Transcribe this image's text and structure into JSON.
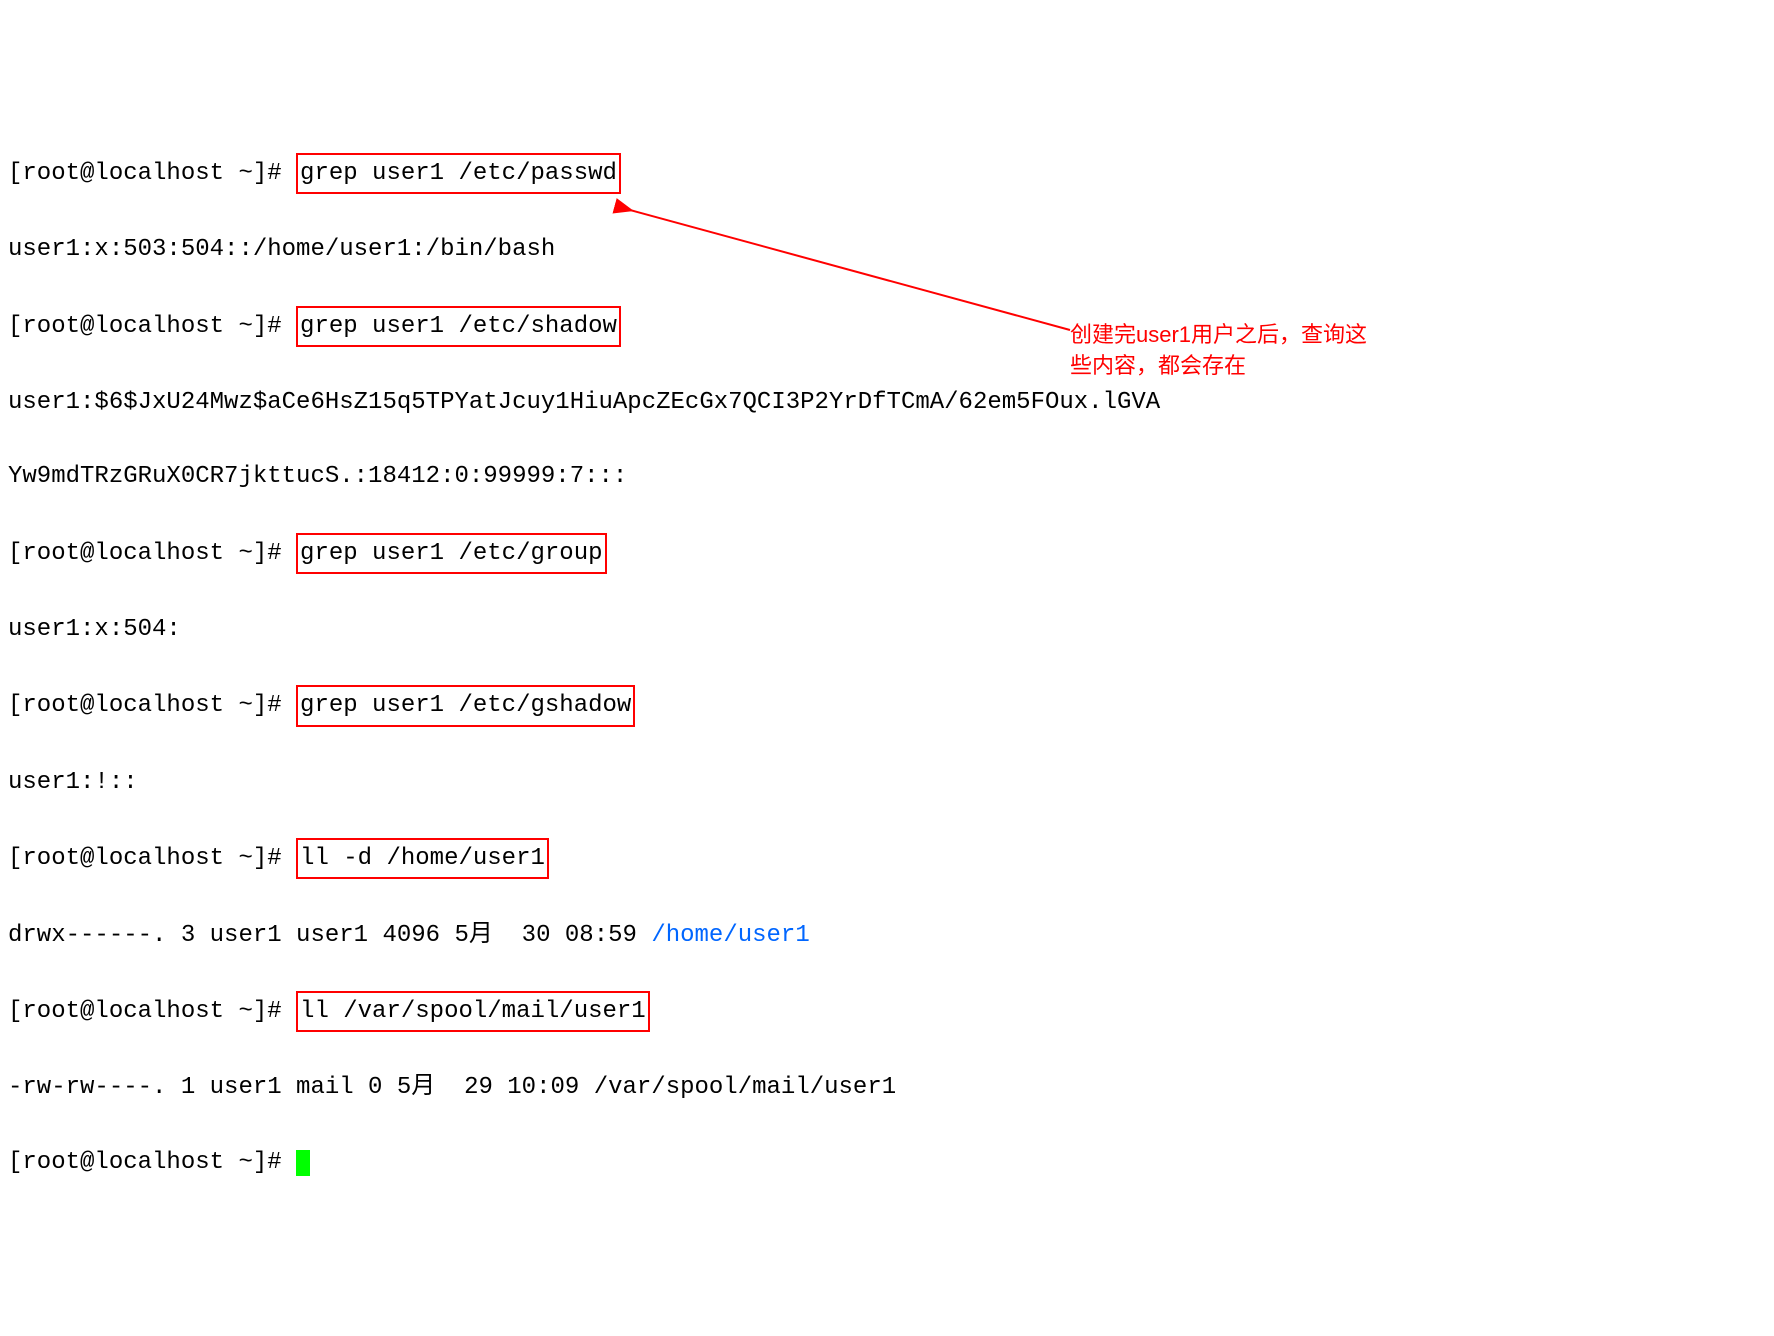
{
  "prompt": "[root@localhost ~]# ",
  "commands": {
    "cmd1": "grep user1 /etc/passwd",
    "cmd2": "grep user1 /etc/shadow",
    "cmd3": "grep user1 /etc/group",
    "cmd4": "grep user1 /etc/gshadow",
    "cmd5": "ll -d /home/user1",
    "cmd6": "ll /var/spool/mail/user1"
  },
  "outputs": {
    "out1": "user1:x:503:504::/home/user1:/bin/bash",
    "out2a": "user1:$6$JxU24Mwz$aCe6HsZ15q5TPYatJcuy1HiuApcZEcGx7QCI3P2YrDfTCmA/62em5FOux.lGVA",
    "out2b": "Yw9mdTRzGRuX0CR7jkttucS.:18412:0:99999:7:::",
    "out3": "user1:x:504:",
    "out4": "user1:!::",
    "out5_prefix": "drwx------. 3 user1 user1 4096 5月  30 08:59 ",
    "out5_path": "/home/user1",
    "out6": "-rw-rw----. 1 user1 mail 0 5月  29 10:09 /var/spool/mail/user1"
  },
  "annotation": {
    "line1": "创建完user1用户之后，查询这",
    "line2": "些内容，都会存在"
  }
}
